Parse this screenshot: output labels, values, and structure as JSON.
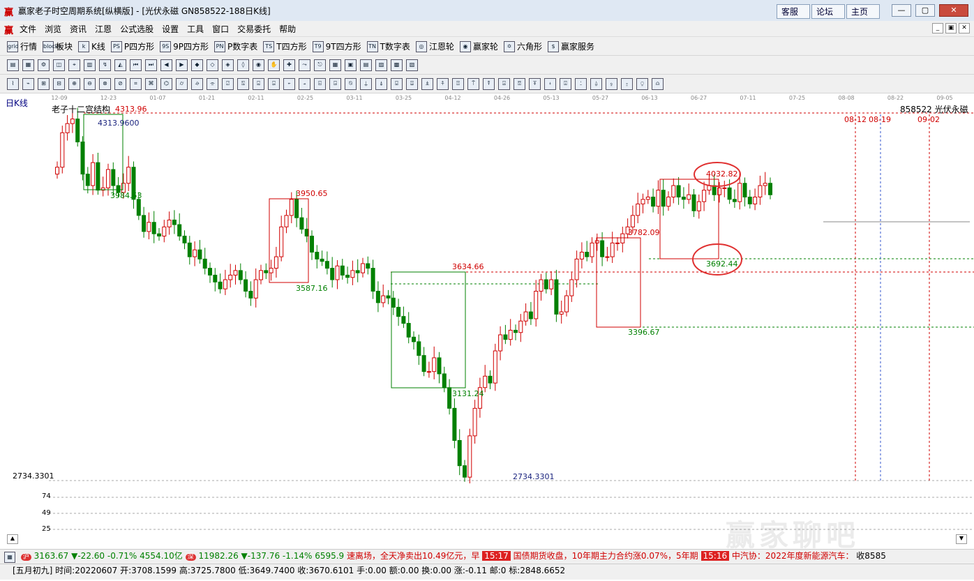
{
  "titlebar": {
    "title": "赢家老子时空周期系统[纵横版] - [光伏永磁  GN858522-188日K线]",
    "links": [
      "客服",
      "论坛",
      "主页"
    ],
    "window_buttons": [
      "—",
      "▢",
      "✕"
    ]
  },
  "menubar": {
    "items": [
      "文件",
      "浏览",
      "资讯",
      "江恩",
      "公式选股",
      "设置",
      "工具",
      "窗口",
      "交易委托",
      "帮助"
    ],
    "mdi_buttons": [
      "_",
      "▣",
      "✕"
    ]
  },
  "toolbar1": {
    "items": [
      {
        "icon": "grid",
        "label": "行情"
      },
      {
        "icon": "blocks",
        "label": "板块"
      },
      {
        "icon": "k",
        "label": "K线"
      },
      {
        "icon": "PS",
        "label": "P四方形"
      },
      {
        "icon": "9S",
        "label": "9P四方形"
      },
      {
        "icon": "PN",
        "label": "P数字表"
      },
      {
        "icon": "TS",
        "label": "T四方形"
      },
      {
        "icon": "T9",
        "label": "9T四方形"
      },
      {
        "icon": "TN",
        "label": "T数字表"
      },
      {
        "icon": "◎",
        "label": "江恩轮"
      },
      {
        "icon": "◉",
        "label": "赢家轮"
      },
      {
        "icon": "✡",
        "label": "六角形"
      },
      {
        "icon": "$",
        "label": "赢家服务"
      }
    ]
  },
  "chart": {
    "period_label": "日K线",
    "indicator_name": "老子十二宫结构",
    "stock_label": "858522 光伏永磁",
    "top_price_label": "4313.96",
    "bottom_axis_value": "2734.3301",
    "vol_axis": [
      "74",
      "49",
      "25"
    ],
    "date_ticks": [
      "12-09",
      "12-23",
      "01-07",
      "01-21",
      "02-11",
      "02-25",
      "03-11",
      "03-25",
      "04-12",
      "04-26",
      "05-13",
      "05-27",
      "06-13",
      "06-27",
      "07-11",
      "07-25",
      "08-08",
      "08-22",
      "09-05"
    ],
    "future_dates": [
      "08-12",
      "08-19",
      "09-02"
    ],
    "annotations": {
      "a4313": "4313.9600",
      "a3984": "3984.53",
      "a3950": "3950.65",
      "a3587": "3587.16",
      "a3634": "3634.66",
      "a3131": "3131.24",
      "a2734": "2734.3301",
      "a3782": "3782.09",
      "a3396": "3396.67",
      "a4032": "4032.82",
      "a3692": "3692.44"
    },
    "colors": {
      "up": "#d00000",
      "down": "#008000",
      "box_red": "#d00000",
      "box_green": "#008000",
      "circle": "#e03030"
    }
  },
  "chart_data": {
    "type": "candlestick",
    "title": "老子十二宫结构",
    "series_name": "858522 光伏永磁",
    "ylim": [
      2734.3301,
      4313.96
    ],
    "key_levels": [
      4313.96,
      3984.53,
      3950.65,
      3587.16,
      3634.66,
      3131.24,
      2734.3301,
      3782.09,
      3396.67,
      4032.82,
      3692.44
    ],
    "close": [
      4090,
      4240,
      4280,
      4300,
      4200,
      4060,
      4010,
      4110,
      3990,
      4000,
      4080,
      4010,
      3980,
      4020,
      4090,
      3950,
      3880,
      3810,
      3850,
      3800,
      3790,
      3830,
      3860,
      3840,
      3790,
      3760,
      3700,
      3730,
      3690,
      3650,
      3620,
      3590,
      3560,
      3600,
      3620,
      3640,
      3600,
      3550,
      3520,
      3600,
      3640,
      3630,
      3650,
      3700,
      3830,
      3880,
      3950,
      3870,
      3820,
      3790,
      3720,
      3690,
      3680,
      3650,
      3600,
      3660,
      3620,
      3610,
      3640,
      3630,
      3670,
      3650,
      3550,
      3500,
      3530,
      3520,
      3480,
      3440,
      3410,
      3350,
      3330,
      3270,
      3200,
      3200,
      3260,
      3190,
      3130,
      3040,
      2900,
      2790,
      2740,
      2920,
      3040,
      3130,
      3180,
      3150,
      3290,
      3360,
      3340,
      3380,
      3370,
      3420,
      3460,
      3430,
      3550,
      3600,
      3560,
      3600,
      3450,
      3460,
      3530,
      3600,
      3690,
      3720,
      3700,
      3760,
      3770,
      3700,
      3700,
      3760,
      3760,
      3800,
      3830,
      3880,
      3930,
      3950,
      3960,
      3920,
      3990,
      3920,
      3960,
      4010,
      3960,
      3950,
      3970,
      3900,
      3940,
      3990,
      4010,
      3970,
      4000,
      4000,
      3950,
      3940,
      4020,
      3960,
      3930,
      3960,
      4010,
      4020,
      3970
    ]
  },
  "status1": {
    "idx1_value": "3163.67",
    "idx1_change": "▼-22.60",
    "idx1_pct": "-0.71%",
    "idx1_amount": "4554.10亿",
    "idx2_value": "11982.26",
    "idx2_change": "▼-137.76",
    "idx2_pct": "-1.14%",
    "idx2_amount": "6595.9",
    "news1": "速离场，全天净卖出10.49亿元，早",
    "time1": "15:17",
    "news2": "国债期货收盘，10年期主力合约涨0.07%，5年期",
    "time2": "15:16",
    "news3": "中汽协：2022年度新能源汽车：",
    "tail": "收8585"
  },
  "status2": {
    "text": "[五月初九] 时间:20220607 开:3708.1599 高:3725.7800 低:3649.7400 收:3670.6101 手:0.00 额:0.00 换:0.00 涨:-0.11 邮:0 标:2848.6652"
  },
  "watermark": {
    "text": "赢家聊吧",
    "url": "liaoba.yjcf360.com"
  }
}
